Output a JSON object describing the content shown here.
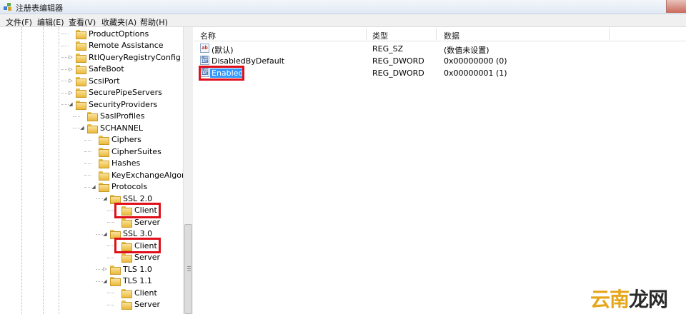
{
  "window": {
    "title": "注册表编辑器"
  },
  "menu": [
    "文件(F)",
    "编辑(E)",
    "查看(V)",
    "收藏夹(A)",
    "帮助(H)"
  ],
  "tree": {
    "nodes": [
      {
        "label": "ProductOptions",
        "expander": "none"
      },
      {
        "label": "Remote Assistance",
        "expander": "none"
      },
      {
        "label": "RtlQueryRegistryConfig",
        "expander": "collapsed"
      },
      {
        "label": "SafeBoot",
        "expander": "collapsed"
      },
      {
        "label": "ScsiPort",
        "expander": "collapsed"
      },
      {
        "label": "SecurePipeServers",
        "expander": "collapsed"
      },
      {
        "label": "SecurityProviders",
        "expander": "expanded"
      },
      {
        "label": "SaslProfiles",
        "expander": "none"
      },
      {
        "label": "SCHANNEL",
        "expander": "expanded"
      },
      {
        "label": "Ciphers",
        "expander": "none"
      },
      {
        "label": "CipherSuites",
        "expander": "none"
      },
      {
        "label": "Hashes",
        "expander": "none"
      },
      {
        "label": "KeyExchangeAlgorithr",
        "expander": "none"
      },
      {
        "label": "Protocols",
        "expander": "expanded"
      },
      {
        "label": "SSL 2.0",
        "expander": "expanded"
      },
      {
        "label": "Client",
        "expander": "none",
        "highlighted": true
      },
      {
        "label": "Server",
        "expander": "none"
      },
      {
        "label": "SSL 3.0",
        "expander": "expanded"
      },
      {
        "label": "Client",
        "expander": "none",
        "highlighted": true
      },
      {
        "label": "Server",
        "expander": "none"
      },
      {
        "label": "TLS 1.0",
        "expander": "collapsed"
      },
      {
        "label": "TLS 1.1",
        "expander": "expanded"
      },
      {
        "label": "Client",
        "expander": "none"
      },
      {
        "label": "Server",
        "expander": "none"
      }
    ]
  },
  "list": {
    "columns": [
      "名称",
      "类型",
      "数据"
    ],
    "rows": [
      {
        "name": "(默认)",
        "type": "REG_SZ",
        "data": "(数值未设置)",
        "icon": "string-value-icon",
        "icon_text": "ab"
      },
      {
        "name": "DisabledByDefault",
        "type": "REG_DWORD",
        "data": "0x00000000 (0)",
        "icon": "binary-value-icon",
        "icon_text": "011 110"
      },
      {
        "name": "Enabled",
        "type": "REG_DWORD",
        "data": "0x00000001 (1)",
        "icon": "binary-value-icon",
        "icon_text": "011 110",
        "selected": true
      }
    ]
  },
  "watermark": {
    "part1": "云南",
    "part2": "龙网"
  },
  "colors": {
    "highlight": "#e0101b",
    "selection": "#3399ff",
    "folder": "#e9b93a"
  }
}
